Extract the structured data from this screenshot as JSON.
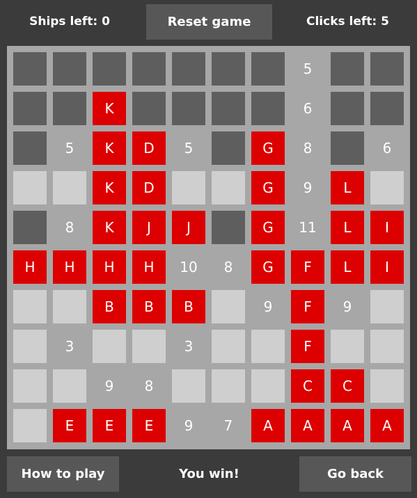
{
  "header": {
    "ships_left": "Ships left: 0",
    "reset_label": "Reset game",
    "clicks_left": "Clicks left: 5"
  },
  "footer": {
    "how_to_play_label": "How to play",
    "status": "You win!",
    "go_back_label": "Go back"
  },
  "colors": {
    "background": "#3b3b3b",
    "board": "#a7a7a7",
    "hidden_cell": "#5e5e5e",
    "empty_cell": "#cfcfcf",
    "ship_cell": "#dc0000",
    "button": "#575757"
  },
  "board": {
    "legend": {
      "#": "hidden",
      "o": "empty",
      "digits": "number",
      "letters": "ship"
    },
    "rows": [
      [
        "#",
        "#",
        "#",
        "#",
        "#",
        "#",
        "#",
        "5",
        "#",
        "#"
      ],
      [
        "#",
        "#",
        "K",
        "#",
        "#",
        "#",
        "#",
        "6",
        "#",
        "#"
      ],
      [
        "#",
        "5",
        "K",
        "D",
        "5",
        "#",
        "G",
        "8",
        "#",
        "6"
      ],
      [
        "o",
        "o",
        "K",
        "D",
        "o",
        "o",
        "G",
        "9",
        "L",
        "o"
      ],
      [
        "#",
        "8",
        "K",
        "J",
        "J",
        "#",
        "G",
        "11",
        "L",
        "I"
      ],
      [
        "H",
        "H",
        "H",
        "H",
        "10",
        "8",
        "G",
        "F",
        "L",
        "I"
      ],
      [
        "o",
        "o",
        "B",
        "B",
        "B",
        "o",
        "9",
        "F",
        "9",
        "o"
      ],
      [
        "o",
        "3",
        "o",
        "o",
        "3",
        "o",
        "o",
        "F",
        "o",
        "o"
      ],
      [
        "o",
        "o",
        "9",
        "8",
        "o",
        "o",
        "o",
        "C",
        "C",
        "o"
      ],
      [
        "o",
        "E",
        "E",
        "E",
        "9",
        "7",
        "A",
        "A",
        "A",
        "A"
      ]
    ]
  }
}
